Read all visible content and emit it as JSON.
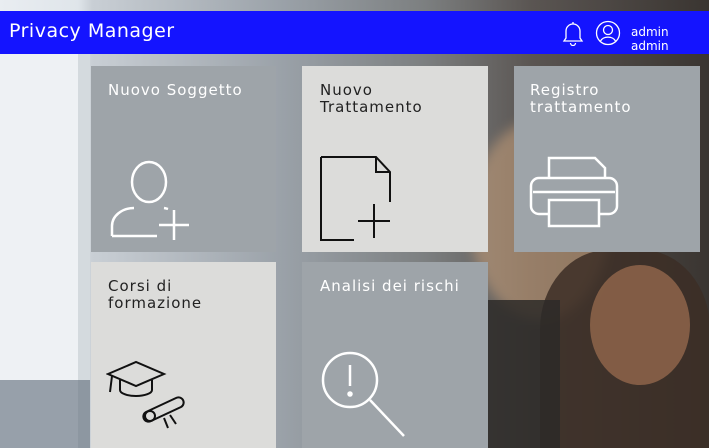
{
  "header": {
    "title": "Privacy Manager",
    "user_name": "admin admin",
    "bell_icon": "bell-icon",
    "user_icon": "user-circle-icon",
    "bar_color": "#1414ff"
  },
  "tiles": [
    {
      "label": "Nuovo Soggetto",
      "icon": "user-add-icon"
    },
    {
      "label": "Nuovo\nTrattamento",
      "icon": "document-add-icon"
    },
    {
      "label": "Registro\ntrattamento",
      "icon": "printer-icon"
    },
    {
      "label": "Corsi di\nformazione",
      "icon": "graduation-cap-diploma-icon"
    },
    {
      "label": "Analisi dei rischi",
      "icon": "magnifier-alert-icon"
    }
  ]
}
